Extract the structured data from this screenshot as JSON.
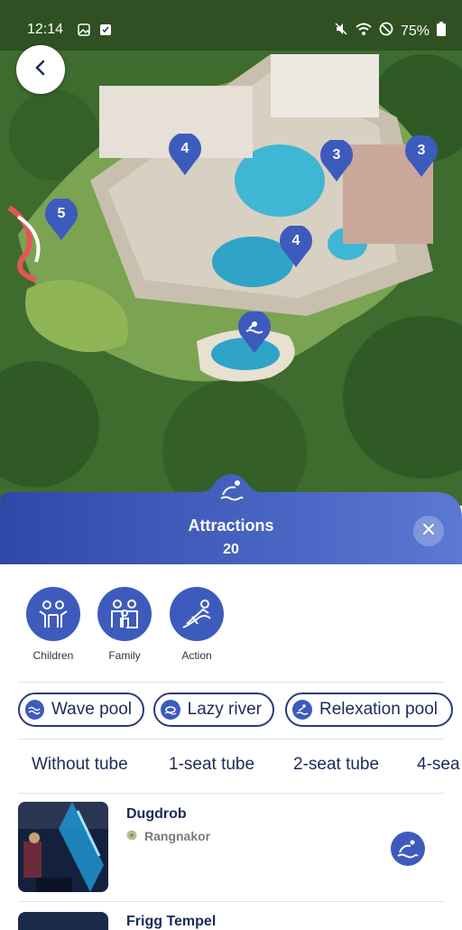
{
  "statusbar": {
    "time": "12:14",
    "battery": "75%"
  },
  "map": {
    "pins": [
      {
        "label": "4"
      },
      {
        "label": "3"
      },
      {
        "label": "3"
      },
      {
        "label": "5"
      },
      {
        "label": "4"
      },
      {
        "label": ""
      }
    ]
  },
  "sheet": {
    "title": "Attractions",
    "count": "20"
  },
  "categories": [
    {
      "label": "Children",
      "icon": "children-icon"
    },
    {
      "label": "Family",
      "icon": "family-icon"
    },
    {
      "label": "Action",
      "icon": "slide-icon"
    }
  ],
  "filters": [
    {
      "label": "Wave pool",
      "icon": "wave-pool-icon"
    },
    {
      "label": "Lazy river",
      "icon": "lazy-river-icon"
    },
    {
      "label": "Relexation pool",
      "icon": "relaxation-pool-icon"
    }
  ],
  "tubes": [
    "Without tube",
    "1-seat tube",
    "2-seat tube",
    "4-sea"
  ],
  "items": [
    {
      "name": "Dugdrob",
      "location": "Rangnakor",
      "type_icon": "water-slide-icon"
    },
    {
      "name": "Frigg Tempel"
    }
  ],
  "colors": {
    "accent": "#3d5bbd",
    "header": "#4a66c4",
    "text": "#1d2a5a"
  }
}
